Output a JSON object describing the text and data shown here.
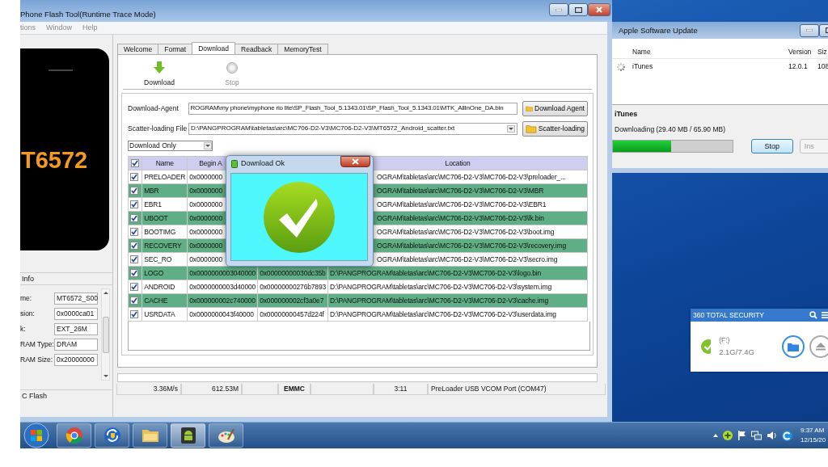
{
  "flash_tool": {
    "title": "Phone Flash Tool(Runtime Trace Mode)",
    "menu": [
      "tions",
      "Window",
      "Help"
    ],
    "device_label": "T6572",
    "info": {
      "title": "Info",
      "fields": [
        {
          "label": "me:",
          "value": "MT6572_S00"
        },
        {
          "label": "sion:",
          "value": "0x0000ca01"
        },
        {
          "label": "k:",
          "value": "EXT_26M"
        },
        {
          "label": "RAM Type:",
          "value": "DRAM"
        },
        {
          "label": "RAM Size:",
          "value": "0x20000000"
        }
      ]
    },
    "flash_section": "C Flash",
    "tabs": [
      {
        "label": "Welcome",
        "selected": false
      },
      {
        "label": "Format",
        "selected": false
      },
      {
        "label": "Download",
        "selected": true
      },
      {
        "label": "Readback",
        "selected": false
      },
      {
        "label": "MemoryTest",
        "selected": false
      }
    ],
    "toolbar": [
      {
        "kind": "download",
        "label": "Download",
        "disabled": false
      },
      {
        "kind": "stop",
        "label": "Stop",
        "disabled": true
      }
    ],
    "download_agent": {
      "label": "Download-Agent",
      "value": "ROGRAM\\my phone\\myphone rio lite\\SP_Flash_Tool_5.1343.01\\SP_Flash_Tool_5.1343.01\\MTK_AllInOne_DA.bin",
      "button": "Download Agent"
    },
    "scatter_file": {
      "label": "Scatter-loading File",
      "value": "D:\\PANGPROGRAM\\tabletas\\arc\\MC706-D2-V3\\MC706-D2-V3\\MT6572_Android_scatter.txt",
      "button": "Scatter-loading"
    },
    "mode": "Download Only",
    "table": {
      "all_checked": true,
      "columns": {
        "name": "Name",
        "begin": "Begin A",
        "location": "Location"
      },
      "rows": [
        {
          "checked": true,
          "highlighted": false,
          "covered": true,
          "name": "PRELOADER",
          "begin": "0x0000000",
          "location": "OGRAM\\tabletas\\arc\\MC706-D2-V3\\MC706-D2-V3\\preloader_..."
        },
        {
          "checked": true,
          "highlighted": true,
          "covered": true,
          "name": "MBR",
          "begin": "0x0000000",
          "location": "OGRAM\\tabletas\\arc\\MC706-D2-V3\\MC706-D2-V3\\MBR"
        },
        {
          "checked": true,
          "highlighted": false,
          "covered": true,
          "name": "EBR1",
          "begin": "0x0000000",
          "location": "OGRAM\\tabletas\\arc\\MC706-D2-V3\\MC706-D2-V3\\EBR1"
        },
        {
          "checked": true,
          "highlighted": true,
          "covered": true,
          "name": "UBOOT",
          "begin": "0x0000000",
          "location": "OGRAM\\tabletas\\arc\\MC706-D2-V3\\MC706-D2-V3\\lk.bin"
        },
        {
          "checked": true,
          "highlighted": false,
          "covered": true,
          "name": "BOOTIMG",
          "begin": "0x0000000",
          "location": "OGRAM\\tabletas\\arc\\MC706-D2-V3\\MC706-D2-V3\\boot.img"
        },
        {
          "checked": true,
          "highlighted": true,
          "covered": true,
          "name": "RECOVERY",
          "begin": "0x0000000",
          "location": "OGRAM\\tabletas\\arc\\MC706-D2-V3\\MC706-D2-V3\\recovery.img"
        },
        {
          "checked": true,
          "highlighted": false,
          "covered": true,
          "name": "SEC_RO",
          "begin": "0x0000000",
          "location": "OGRAM\\tabletas\\arc\\MC706-D2-V3\\MC706-D2-V3\\secro.img"
        },
        {
          "checked": true,
          "highlighted": true,
          "covered": false,
          "name": "LOGO",
          "begin": "0x0000000003040000",
          "end": "0x00000000030dc35b",
          "location": "D:\\PANGPROGRAM\\tabletas\\arc\\MC706-D2-V3\\MC706-D2-V3\\logo.bin"
        },
        {
          "checked": true,
          "highlighted": false,
          "covered": false,
          "name": "ANDROID",
          "begin": "0x0000000003d40000",
          "end": "0x00000000276b7893",
          "location": "D:\\PANGPROGRAM\\tabletas\\arc\\MC706-D2-V3\\MC706-D2-V3\\system.img"
        },
        {
          "checked": true,
          "highlighted": true,
          "covered": false,
          "name": "CACHE",
          "begin": "0x000000002c740000",
          "end": "0x000000002cf3a0e7",
          "location": "D:\\PANGPROGRAM\\tabletas\\arc\\MC706-D2-V3\\MC706-D2-V3\\cache.img"
        },
        {
          "checked": true,
          "highlighted": false,
          "covered": false,
          "name": "USRDATA",
          "begin": "0x0000000043f40000",
          "end": "0x00000000457d224f",
          "location": "D:\\PANGPROGRAM\\tabletas\\arc\\MC706-D2-V3\\MC706-D2-V3\\userdata.img"
        }
      ]
    },
    "status_bar": {
      "speed": "3.36M/s",
      "size": "612.53M",
      "storage": "EMMC",
      "time": "3:11",
      "port": "PreLoader USB VCOM Port (COM47)"
    }
  },
  "dialog": {
    "title": "Download Ok"
  },
  "apple_update": {
    "title": "Apple Software Update",
    "columns": {
      "name": "Name",
      "version": "Version",
      "size": "Siz"
    },
    "item": {
      "name": "iTunes",
      "version": "12.0.1",
      "size": "108"
    },
    "current": "iTunes",
    "status": "Downloading (29.40 MB / 65.90 MB)",
    "progress": {
      "level": 0.49
    },
    "buttons": [
      {
        "label": "Stop",
        "disabled": false
      },
      {
        "label": "Ins",
        "disabled": true
      }
    ]
  },
  "security": {
    "title": "360 TOTAL SECURITY",
    "drive": "(F:)",
    "usage": "2.1G/7.4G"
  },
  "taskbar": {
    "items": [
      {
        "kind": "browser",
        "selected": false
      },
      {
        "kind": "update",
        "selected": false
      },
      {
        "kind": "folder",
        "selected": false
      },
      {
        "kind": "android",
        "selected": true
      },
      {
        "kind": "paint",
        "selected": false
      }
    ],
    "clock": {
      "time": "9:37 AM",
      "date": "12/15/20"
    }
  }
}
